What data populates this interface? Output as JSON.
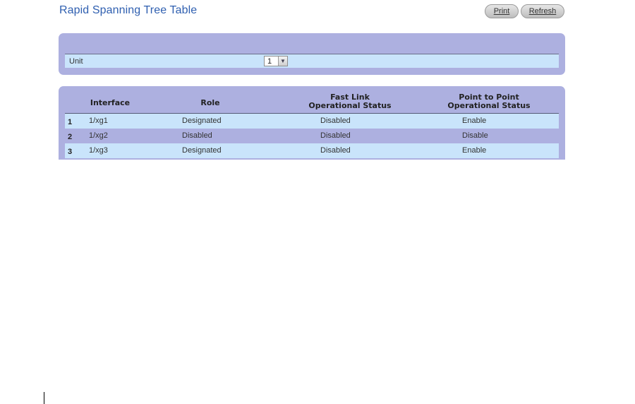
{
  "page": {
    "title": "Rapid Spanning Tree Table"
  },
  "toolbar": {
    "print_label": "Print",
    "refresh_label": "Refresh"
  },
  "unit": {
    "label": "Unit",
    "selected": "1"
  },
  "table": {
    "headers": {
      "interface": "Interface",
      "role": "Role",
      "fast_link_1": "Fast Link",
      "fast_link_2": "Operational Status",
      "p2p_1": "Point to Point",
      "p2p_2": "Operational Status"
    },
    "rows": [
      {
        "index": "1",
        "interface": "1/xg1",
        "role": "Designated",
        "fast_link": "Disabled",
        "p2p": "Enable"
      },
      {
        "index": "2",
        "interface": "1/xg2",
        "role": "Disabled",
        "fast_link": "Disabled",
        "p2p": "Disable"
      },
      {
        "index": "3",
        "interface": "1/xg3",
        "role": "Designated",
        "fast_link": "Disabled",
        "p2p": "Enable"
      }
    ]
  }
}
